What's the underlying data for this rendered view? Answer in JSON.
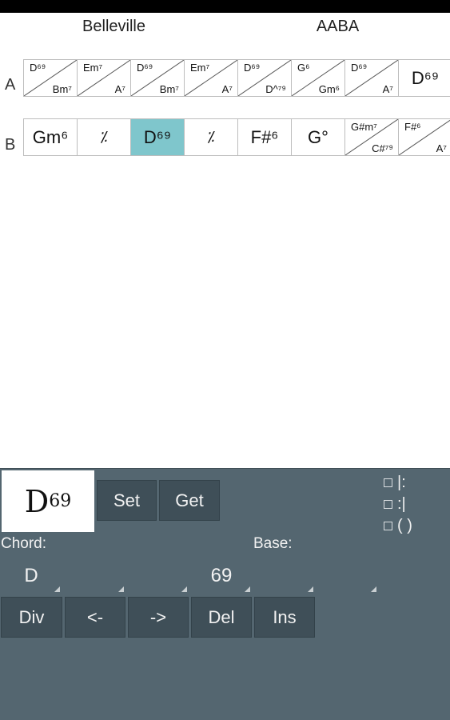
{
  "song": {
    "title": "Belleville",
    "form": "AABA"
  },
  "sections": [
    {
      "label": "A",
      "bars": [
        {
          "type": "split",
          "top": "D⁶⁹",
          "bottom": "Bm⁷"
        },
        {
          "type": "split",
          "top": "Em⁷",
          "bottom": "A⁷"
        },
        {
          "type": "split",
          "top": "D⁶⁹",
          "bottom": "Bm⁷"
        },
        {
          "type": "split",
          "top": "Em⁷",
          "bottom": "A⁷"
        },
        {
          "type": "split",
          "top": "D⁶⁹",
          "bottom": "D^⁷⁹"
        },
        {
          "type": "split",
          "top": "G⁶",
          "bottom": "Gm⁶"
        },
        {
          "type": "split",
          "top": "D⁶⁹",
          "bottom": "A⁷"
        },
        {
          "type": "single",
          "chord": "D⁶⁹"
        }
      ]
    },
    {
      "label": "B",
      "bars": [
        {
          "type": "single",
          "chord": "Gm⁶"
        },
        {
          "type": "repeat",
          "chord": "⁒"
        },
        {
          "type": "single",
          "chord": "D⁶⁹",
          "selected": true
        },
        {
          "type": "repeat",
          "chord": "⁒"
        },
        {
          "type": "single",
          "chord": "F#⁶"
        },
        {
          "type": "single",
          "chord": "G°"
        },
        {
          "type": "split",
          "top": "G#m⁷",
          "bottom": "C#⁷⁹"
        },
        {
          "type": "split",
          "top": "F#⁶",
          "bottom": "A⁷"
        }
      ]
    }
  ],
  "editor": {
    "preview_root": "D",
    "preview_ext": "69",
    "set_label": "Set",
    "get_label": "Get",
    "checkboxes": [
      {
        "label": "|:",
        "checked": false
      },
      {
        "label": ":|",
        "checked": false
      },
      {
        "label": "( )",
        "checked": false
      }
    ],
    "chord_label": "Chord:",
    "base_label": "Base:",
    "spinners": [
      "D",
      "",
      "",
      "69",
      "",
      ""
    ],
    "buttons": {
      "div": "Div",
      "left": "<-",
      "right": "->",
      "del": "Del",
      "ins": "Ins"
    }
  },
  "colors": {
    "selected_bar": "#7fc6cc",
    "panel": "#546670",
    "button": "#3f4f58"
  }
}
